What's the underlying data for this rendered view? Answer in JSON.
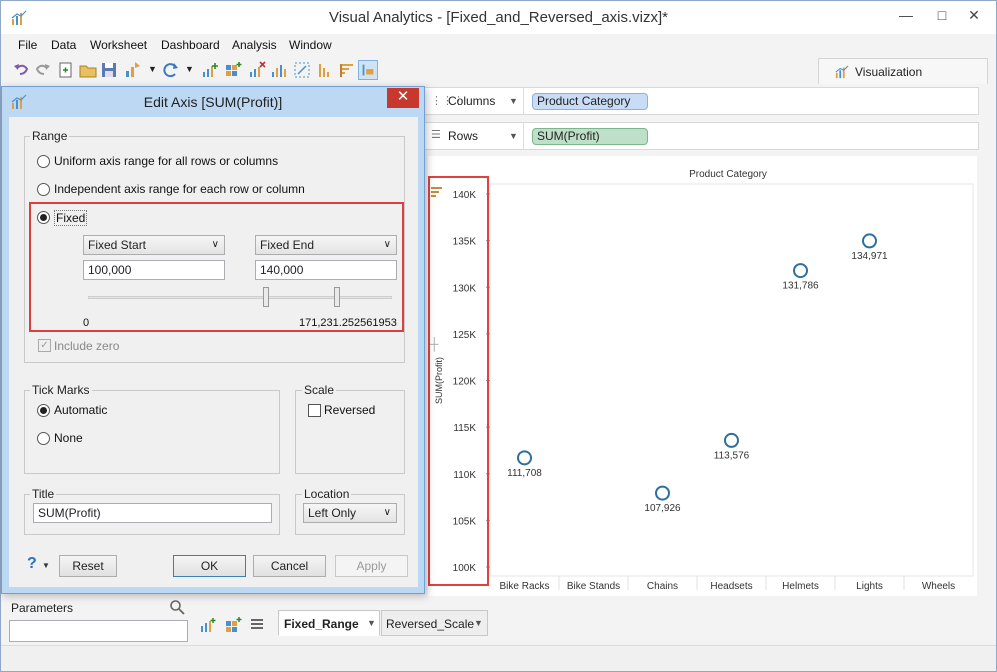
{
  "window": {
    "title": "Visual Analytics - [Fixed_and_Reversed_axis.vizx]*"
  },
  "menu": [
    "File",
    "Data",
    "Worksheet",
    "Dashboard",
    "Analysis",
    "Window"
  ],
  "viz_tab": {
    "label": "Visualization"
  },
  "shelves": {
    "columns": {
      "label": "Columns",
      "pill": "Product Category"
    },
    "rows": {
      "label": "Rows",
      "pill": "SUM(Profit)"
    }
  },
  "dialog": {
    "title": "Edit Axis [SUM(Profit)]",
    "range": {
      "label": "Range",
      "uniform": "Uniform axis range for all rows or columns",
      "independent": "Independent axis range for each row or column",
      "fixed": "Fixed",
      "start_select": "Fixed Start",
      "end_select": "Fixed End",
      "start_value": "100,000",
      "end_value": "140,000",
      "slider_min": "0",
      "slider_max": "171,231.252561953",
      "include_zero": "Include zero"
    },
    "tick_marks": {
      "label": "Tick Marks",
      "automatic": "Automatic",
      "none": "None"
    },
    "scale": {
      "label": "Scale",
      "reversed": "Reversed"
    },
    "title_group": {
      "label": "Title",
      "value": "SUM(Profit)"
    },
    "location": {
      "label": "Location",
      "value": "Left Only"
    },
    "buttons": {
      "reset": "Reset",
      "ok": "OK",
      "cancel": "Cancel",
      "apply": "Apply",
      "help": "?"
    }
  },
  "chart_data": {
    "type": "scatter",
    "title": "Product Category",
    "ylabel": "SUM(Profit)",
    "ylim": [
      100000,
      140000
    ],
    "yticks": [
      "100K",
      "105K",
      "110K",
      "115K",
      "120K",
      "125K",
      "130K",
      "135K",
      "140K"
    ],
    "categories": [
      "Bike Racks",
      "Bike Stands",
      "Chains",
      "Headsets",
      "Helmets",
      "Lights",
      "Wheels"
    ],
    "points": [
      {
        "category": "Bike Racks",
        "value": 111708,
        "label": "111,708"
      },
      {
        "category": "Chains",
        "value": 107926,
        "label": "107,926"
      },
      {
        "category": "Headsets",
        "value": 113576,
        "label": "113,576"
      },
      {
        "category": "Helmets",
        "value": 131786,
        "label": "131,786"
      },
      {
        "category": "Lights",
        "value": 134971,
        "label": "134,971"
      }
    ],
    "point_color": "#2e6f9e"
  },
  "bottom": {
    "parameters_label": "Parameters",
    "sheets": [
      "Fixed_Range",
      "Reversed_Scale"
    ]
  }
}
